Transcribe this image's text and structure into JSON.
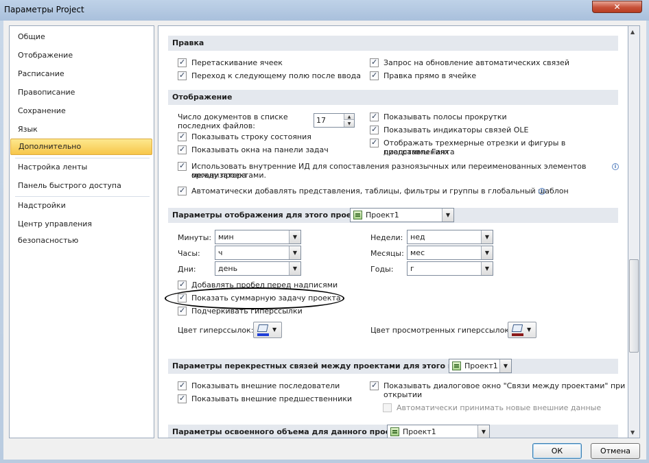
{
  "window": {
    "title": "Параметры Project",
    "close_glyph": "✕"
  },
  "sidebar": {
    "items": [
      {
        "label": "Общие"
      },
      {
        "label": "Отображение"
      },
      {
        "label": "Расписание"
      },
      {
        "label": "Правописание"
      },
      {
        "label": "Сохранение"
      },
      {
        "label": "Язык"
      },
      {
        "label": "Дополнительно",
        "selected": true
      },
      {
        "label": "Настройка ленты"
      },
      {
        "label": "Панель быстрого доступа"
      },
      {
        "label": "Надстройки"
      },
      {
        "label": "Центр управления безопасностью"
      }
    ]
  },
  "edit_section": {
    "title": "Правка",
    "options": [
      {
        "label": "Перетаскивание ячеек",
        "checked": true
      },
      {
        "label": "Запрос на обновление автоматических связей",
        "checked": true
      },
      {
        "label": "Переход к следующему полю после ввода",
        "checked": true
      },
      {
        "label": "Правка прямо в ячейке",
        "checked": true
      }
    ]
  },
  "display_section": {
    "title": "Отображение",
    "recent_files_label_1": "Число документов в списке",
    "recent_files_label_2": "последних файлов:",
    "recent_files_value": "17",
    "options": [
      {
        "label": "Показывать строку состояния",
        "checked": true
      },
      {
        "label": "Показывать окна на панели задач",
        "checked": true
      },
      {
        "label": "Показывать полосы прокрутки",
        "checked": true
      },
      {
        "label": "Показывать индикаторы связей OLE",
        "checked": true
      },
      {
        "label": "Отображать трехмерные отрезки и фигуры в представлениях",
        "label2": "диаграммы Ганта",
        "checked": true
      },
      {
        "label": "Использовать внутренние ИД для сопоставления разноязычных или переименованных элементов организатора",
        "label2": "между проектами.",
        "checked": true
      },
      {
        "label": "Автоматически добавлять представления, таблицы, фильтры и группы в глобальный шаблон",
        "checked": true
      }
    ]
  },
  "project_display_section": {
    "title": "Параметры отображения для этого проекта:",
    "project_value": "Проект1",
    "units": [
      {
        "label": "Минуты:",
        "value": "мин"
      },
      {
        "label": "Часы:",
        "value": "ч"
      },
      {
        "label": "Дни:",
        "value": "день"
      },
      {
        "label": "Недели:",
        "value": "нед"
      },
      {
        "label": "Месяцы:",
        "value": "мес"
      },
      {
        "label": "Годы:",
        "value": "г"
      }
    ],
    "options": [
      {
        "label": "Добавлять пробел перед надписями",
        "checked": true
      },
      {
        "label": "Показать суммарную задачу проекта",
        "checked": true
      },
      {
        "label": "Подчеркивать гиперссылки",
        "checked": true
      }
    ],
    "hyperlink_color_label": "Цвет гиперссылок:",
    "visited_color_label": "Цвет просмотренных гиперссылок:",
    "hyperlink_color": "#1f3fd8",
    "visited_color": "#8b1a1a"
  },
  "cross_project_section": {
    "title": "Параметры перекрестных связей между проектами для этого проекта:",
    "project_value": "Проект1",
    "options": [
      {
        "label": "Показывать внешние последователи",
        "checked": true
      },
      {
        "label": "Показывать внешние предшественники",
        "checked": true
      },
      {
        "label": "Показывать диалоговое окно \"Связи между проектами\" при",
        "label2": "открытии",
        "checked": true
      },
      {
        "label": "Автоматически принимать новые внешние данные",
        "checked": false,
        "disabled": true
      }
    ]
  },
  "earned_value_section": {
    "title": "Параметры освоенного объема для данного проекта:",
    "project_value": "Проект1"
  },
  "footer": {
    "ok_label": "ОК",
    "cancel_label": "Отмена"
  }
}
